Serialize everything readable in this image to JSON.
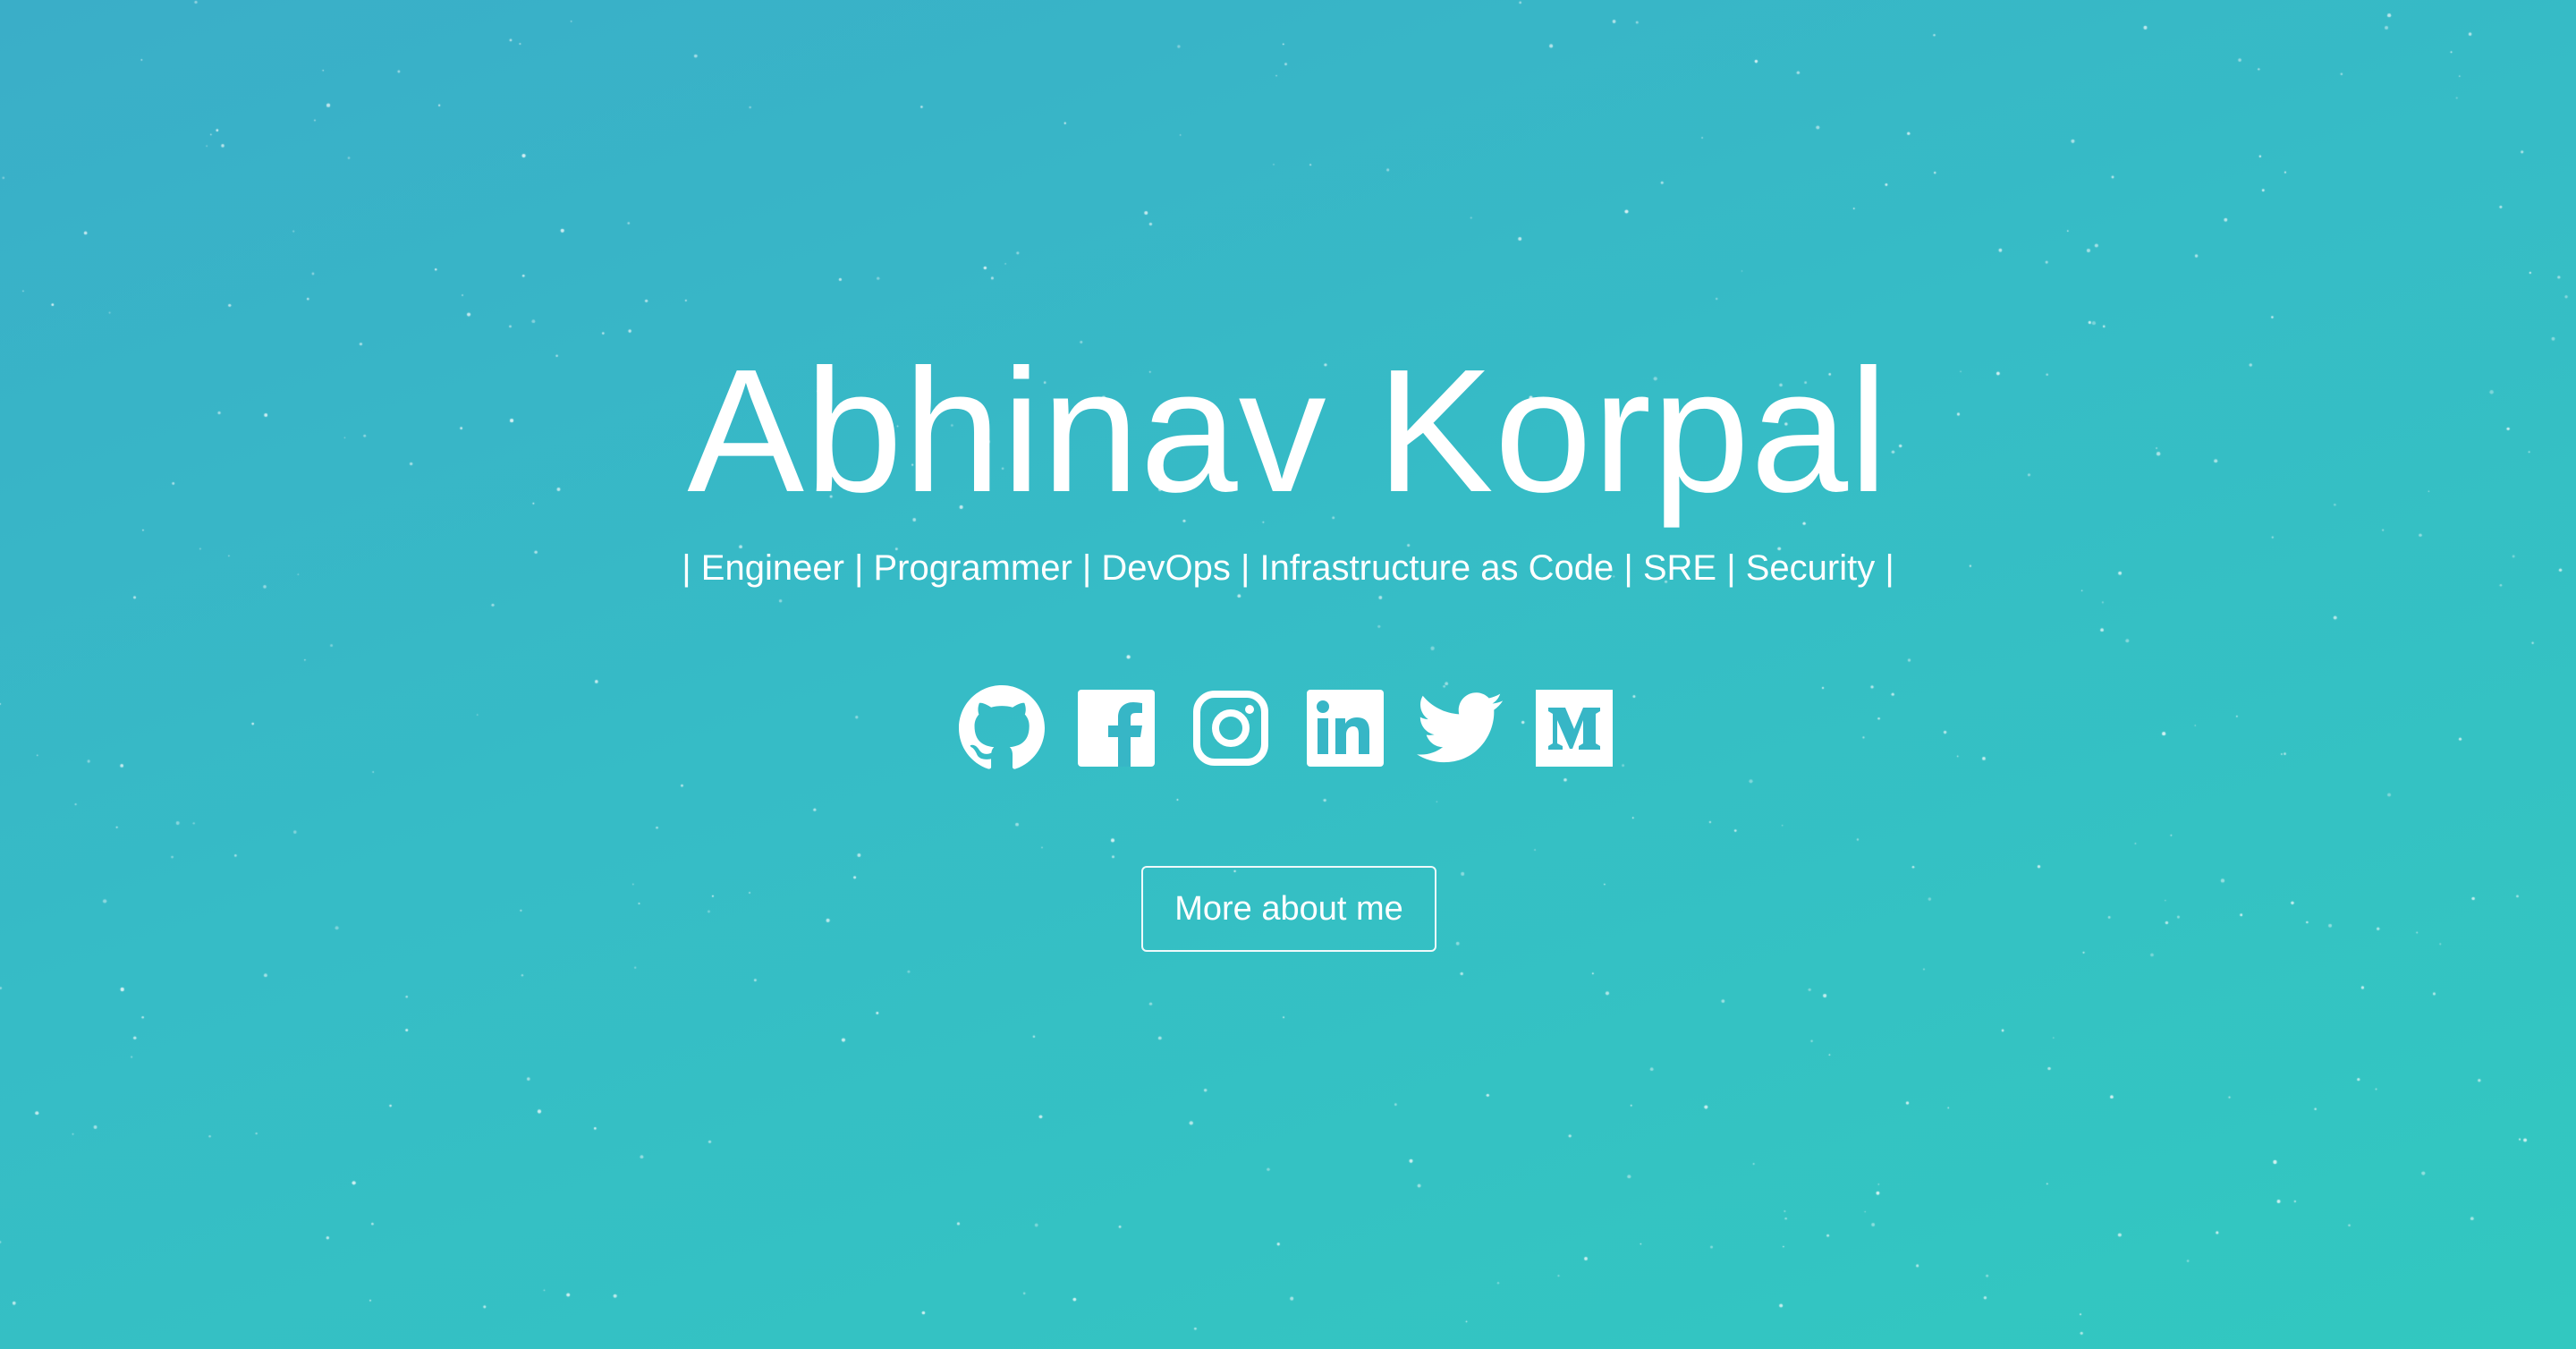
{
  "hero": {
    "name": "Abhinav Korpal",
    "tagline": "| Engineer | Programmer | DevOps | Infrastructure as Code | SRE | Security |",
    "cta_label": "More about me"
  },
  "socials": [
    {
      "icon": "github-icon"
    },
    {
      "icon": "facebook-icon"
    },
    {
      "icon": "instagram-icon"
    },
    {
      "icon": "linkedin-icon"
    },
    {
      "icon": "twitter-icon"
    },
    {
      "icon": "medium-icon"
    }
  ],
  "colors": {
    "gradient_start": "#3aaec8",
    "gradient_end": "#32c8c0",
    "text": "#ffffff"
  }
}
